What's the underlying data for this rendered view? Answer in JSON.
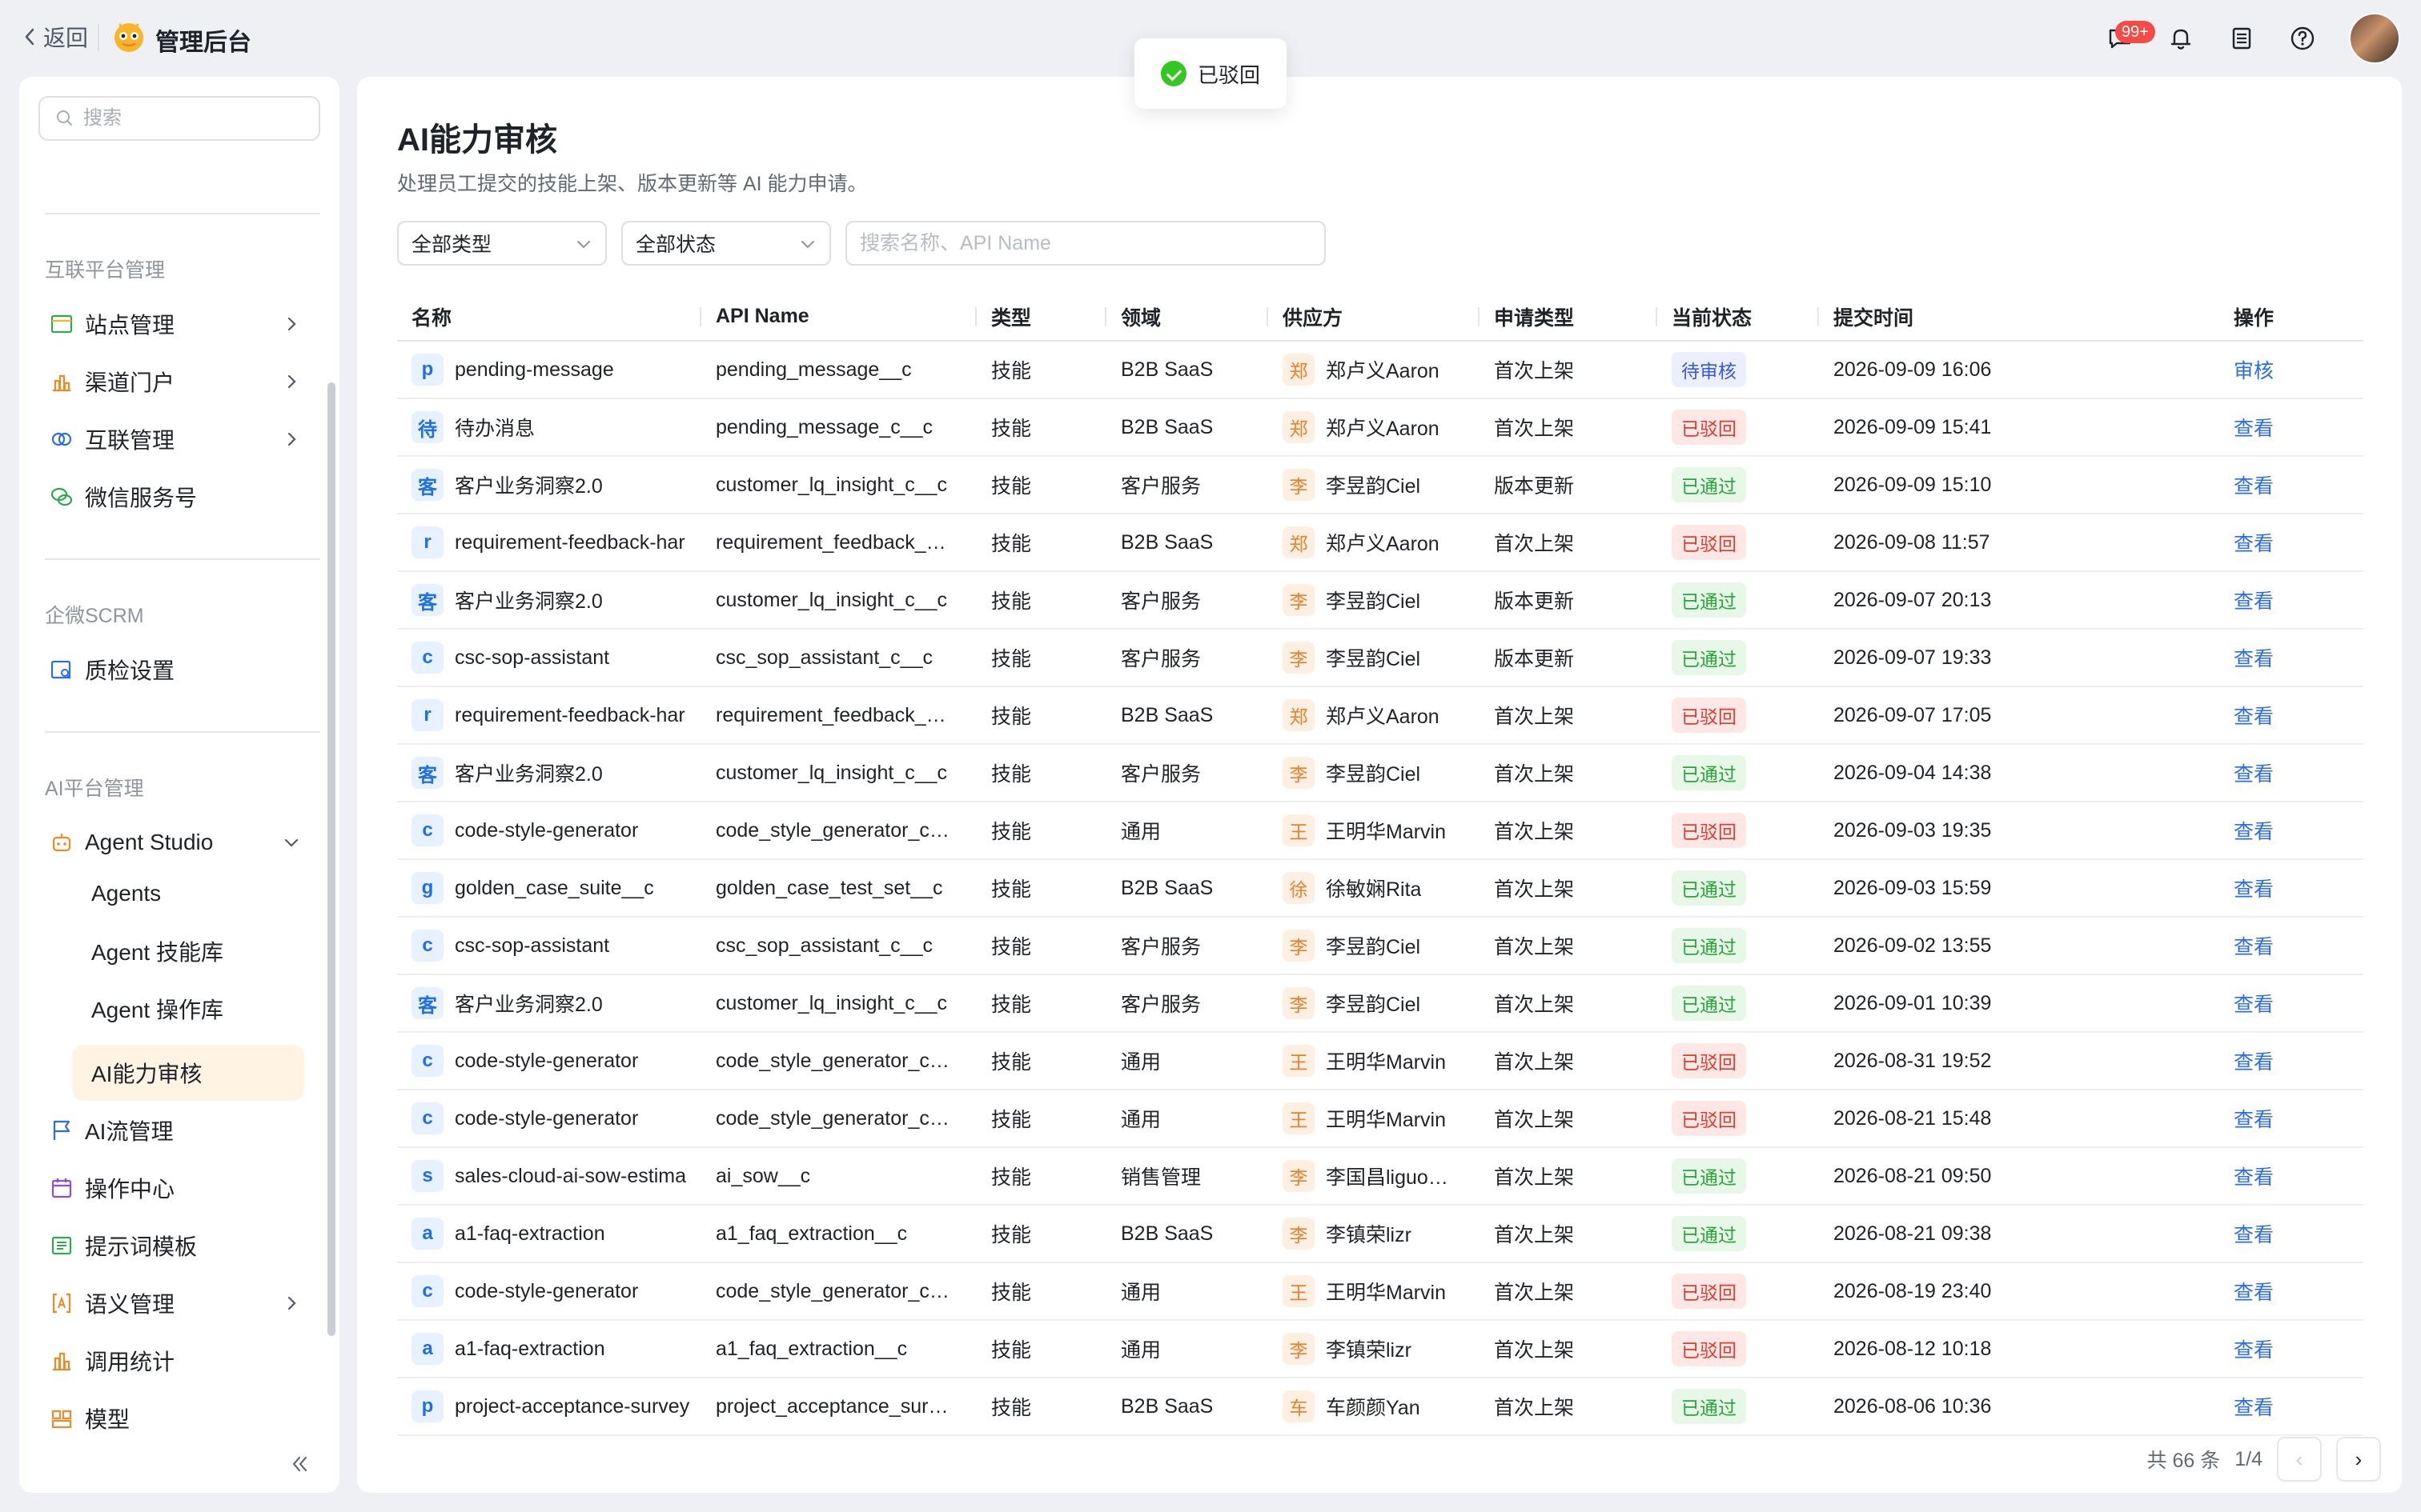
{
  "topbar": {
    "back_label": "返回",
    "app_title": "管理后台",
    "message_badge": "99+"
  },
  "toast": {
    "text": "已驳回"
  },
  "sidebar": {
    "search_placeholder": "搜索",
    "sections": [
      {
        "title": "互联平台管理"
      },
      {
        "title": "企微SCRM"
      },
      {
        "title": "AI平台管理"
      }
    ],
    "items": [
      {
        "label": "站点管理",
        "icon": "site-icon"
      },
      {
        "label": "渠道门户",
        "icon": "chart-icon"
      },
      {
        "label": "互联管理",
        "icon": "link-icon"
      },
      {
        "label": "微信服务号",
        "icon": "wechat-icon"
      },
      {
        "label": "质检设置",
        "icon": "inspect-icon"
      },
      {
        "label": "Agent Studio",
        "icon": "robot-icon"
      },
      {
        "label": "AI流管理",
        "icon": "flag-icon"
      },
      {
        "label": "操作中心",
        "icon": "calendar-icon"
      },
      {
        "label": "提示词模板",
        "icon": "template-icon"
      },
      {
        "label": "语义管理",
        "icon": "bracket-icon"
      },
      {
        "label": "调用统计",
        "icon": "stats-icon"
      },
      {
        "label": "模型",
        "icon": "model-icon"
      }
    ],
    "subitems": [
      {
        "label": "Agents"
      },
      {
        "label": "Agent 技能库"
      },
      {
        "label": "Agent 操作库"
      },
      {
        "label": "AI能力审核"
      }
    ]
  },
  "main": {
    "title": "AI能力审核",
    "description": "处理员工提交的技能上架、版本更新等 AI 能力申请。",
    "filters": {
      "type": "全部类型",
      "status": "全部状态",
      "search_placeholder": "搜索名称、API Name"
    },
    "columns": [
      "名称",
      "API Name",
      "类型",
      "领域",
      "供应方",
      "申请类型",
      "当前状态",
      "提交时间",
      "操作"
    ],
    "rows": [
      {
        "badge": "p",
        "name": "pending-message",
        "api": "pending_message__c",
        "type": "技能",
        "domain": "B2B SaaS",
        "pbadge": "郑",
        "provider": "郑卢义Aaron",
        "apply": "首次上架",
        "status": "待审核",
        "status_kind": "pend",
        "time": "2026-09-09 16:06",
        "action": "审核"
      },
      {
        "badge": "待",
        "name": "待办消息",
        "api": "pending_message_c__c",
        "type": "技能",
        "domain": "B2B SaaS",
        "pbadge": "郑",
        "provider": "郑卢义Aaron",
        "apply": "首次上架",
        "status": "已驳回",
        "status_kind": "rej",
        "time": "2026-09-09 15:41",
        "action": "查看"
      },
      {
        "badge": "客",
        "name": "客户业务洞察2.0",
        "api": "customer_lq_insight_c__c",
        "type": "技能",
        "domain": "客户服务",
        "pbadge": "李",
        "provider": "李昱韵Ciel",
        "apply": "版本更新",
        "status": "已通过",
        "status_kind": "ok",
        "time": "2026-09-09 15:10",
        "action": "查看"
      },
      {
        "badge": "r",
        "name": "requirement-feedback-har",
        "api": "requirement_feedback_…",
        "type": "技能",
        "domain": "B2B SaaS",
        "pbadge": "郑",
        "provider": "郑卢义Aaron",
        "apply": "首次上架",
        "status": "已驳回",
        "status_kind": "rej",
        "time": "2026-09-08 11:57",
        "action": "查看"
      },
      {
        "badge": "客",
        "name": "客户业务洞察2.0",
        "api": "customer_lq_insight_c__c",
        "type": "技能",
        "domain": "客户服务",
        "pbadge": "李",
        "provider": "李昱韵Ciel",
        "apply": "版本更新",
        "status": "已通过",
        "status_kind": "ok",
        "time": "2026-09-07 20:13",
        "action": "查看"
      },
      {
        "badge": "c",
        "name": "csc-sop-assistant",
        "api": "csc_sop_assistant_c__c",
        "type": "技能",
        "domain": "客户服务",
        "pbadge": "李",
        "provider": "李昱韵Ciel",
        "apply": "版本更新",
        "status": "已通过",
        "status_kind": "ok",
        "time": "2026-09-07 19:33",
        "action": "查看"
      },
      {
        "badge": "r",
        "name": "requirement-feedback-har",
        "api": "requirement_feedback_…",
        "type": "技能",
        "domain": "B2B SaaS",
        "pbadge": "郑",
        "provider": "郑卢义Aaron",
        "apply": "首次上架",
        "status": "已驳回",
        "status_kind": "rej",
        "time": "2026-09-07 17:05",
        "action": "查看"
      },
      {
        "badge": "客",
        "name": "客户业务洞察2.0",
        "api": "customer_lq_insight_c__c",
        "type": "技能",
        "domain": "客户服务",
        "pbadge": "李",
        "provider": "李昱韵Ciel",
        "apply": "首次上架",
        "status": "已通过",
        "status_kind": "ok",
        "time": "2026-09-04 14:38",
        "action": "查看"
      },
      {
        "badge": "c",
        "name": "code-style-generator",
        "api": "code_style_generator_c…",
        "type": "技能",
        "domain": "通用",
        "pbadge": "王",
        "provider": "王明华Marvin",
        "apply": "首次上架",
        "status": "已驳回",
        "status_kind": "rej",
        "time": "2026-09-03 19:35",
        "action": "查看"
      },
      {
        "badge": "g",
        "name": "golden_case_suite__c",
        "api": "golden_case_test_set__c",
        "type": "技能",
        "domain": "B2B SaaS",
        "pbadge": "徐",
        "provider": "徐敏娴Rita",
        "apply": "首次上架",
        "status": "已通过",
        "status_kind": "ok",
        "time": "2026-09-03 15:59",
        "action": "查看"
      },
      {
        "badge": "c",
        "name": "csc-sop-assistant",
        "api": "csc_sop_assistant_c__c",
        "type": "技能",
        "domain": "客户服务",
        "pbadge": "李",
        "provider": "李昱韵Ciel",
        "apply": "首次上架",
        "status": "已通过",
        "status_kind": "ok",
        "time": "2026-09-02 13:55",
        "action": "查看"
      },
      {
        "badge": "客",
        "name": "客户业务洞察2.0",
        "api": "customer_lq_insight_c__c",
        "type": "技能",
        "domain": "客户服务",
        "pbadge": "李",
        "provider": "李昱韵Ciel",
        "apply": "首次上架",
        "status": "已通过",
        "status_kind": "ok",
        "time": "2026-09-01 10:39",
        "action": "查看"
      },
      {
        "badge": "c",
        "name": "code-style-generator",
        "api": "code_style_generator_c…",
        "type": "技能",
        "domain": "通用",
        "pbadge": "王",
        "provider": "王明华Marvin",
        "apply": "首次上架",
        "status": "已驳回",
        "status_kind": "rej",
        "time": "2026-08-31 19:52",
        "action": "查看"
      },
      {
        "badge": "c",
        "name": "code-style-generator",
        "api": "code_style_generator_c…",
        "type": "技能",
        "domain": "通用",
        "pbadge": "王",
        "provider": "王明华Marvin",
        "apply": "首次上架",
        "status": "已驳回",
        "status_kind": "rej",
        "time": "2026-08-21 15:48",
        "action": "查看"
      },
      {
        "badge": "s",
        "name": "sales-cloud-ai-sow-estima",
        "api": "ai_sow__c",
        "type": "技能",
        "domain": "销售管理",
        "pbadge": "李",
        "provider": "李国昌liguo…",
        "apply": "首次上架",
        "status": "已通过",
        "status_kind": "ok",
        "time": "2026-08-21 09:50",
        "action": "查看"
      },
      {
        "badge": "a",
        "name": "a1-faq-extraction",
        "api": "a1_faq_extraction__c",
        "type": "技能",
        "domain": "B2B SaaS",
        "pbadge": "李",
        "provider": "李镇荣lizr",
        "apply": "首次上架",
        "status": "已通过",
        "status_kind": "ok",
        "time": "2026-08-21 09:38",
        "action": "查看"
      },
      {
        "badge": "c",
        "name": "code-style-generator",
        "api": "code_style_generator_c…",
        "type": "技能",
        "domain": "通用",
        "pbadge": "王",
        "provider": "王明华Marvin",
        "apply": "首次上架",
        "status": "已驳回",
        "status_kind": "rej",
        "time": "2026-08-19 23:40",
        "action": "查看"
      },
      {
        "badge": "a",
        "name": "a1-faq-extraction",
        "api": "a1_faq_extraction__c",
        "type": "技能",
        "domain": "通用",
        "pbadge": "李",
        "provider": "李镇荣lizr",
        "apply": "首次上架",
        "status": "已驳回",
        "status_kind": "rej",
        "time": "2026-08-12 10:18",
        "action": "查看"
      },
      {
        "badge": "p",
        "name": "project-acceptance-survey",
        "api": "project_acceptance_sur…",
        "type": "技能",
        "domain": "B2B SaaS",
        "pbadge": "车",
        "provider": "车颜颜Yan",
        "apply": "首次上架",
        "status": "已通过",
        "status_kind": "ok",
        "time": "2026-08-06 10:36",
        "action": "查看"
      }
    ],
    "pagination": {
      "total": "共 66 条",
      "page": "1/4",
      "prev": "‹",
      "next": "›"
    }
  },
  "colors": {
    "accent": "#2b6de6",
    "active_bg": "#fff4e3",
    "rejected": "#e03b2f",
    "approved": "#29a33a",
    "pending": "#3656e6"
  }
}
